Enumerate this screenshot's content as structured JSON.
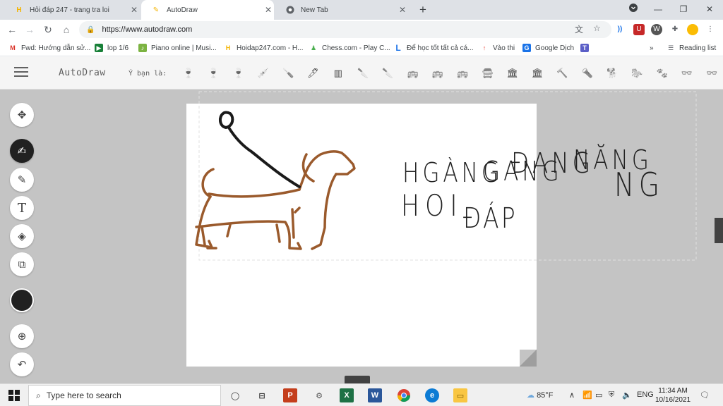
{
  "browser": {
    "tabs": [
      {
        "title": "Hỏi đáp 247 - trang tra loi",
        "icon": "hoidap-favicon"
      },
      {
        "title": "AutoDraw",
        "icon": "autodraw-favicon"
      },
      {
        "title": "New Tab",
        "icon": "chrome-favicon"
      }
    ],
    "url": "https://www.autodraw.com",
    "bookmarks": [
      {
        "label": "Fwd: Hướng dẫn sử...",
        "icon": "gmail-icon",
        "color": "#d93025"
      },
      {
        "label": "lop 1/6",
        "icon": "meet-icon",
        "color": "#188038"
      },
      {
        "label": "Piano online | Musi...",
        "icon": "piano-icon",
        "color": "#7cb342"
      },
      {
        "label": "Hoidap247.com - H...",
        "icon": "hoidap-icon",
        "color": "#f4b400"
      },
      {
        "label": "Chess.com - Play C...",
        "icon": "chess-icon",
        "color": "#4caf50"
      },
      {
        "label": "Để học tốt tất cả cá...",
        "icon": "loigiaihay-icon",
        "color": "#1a73e8"
      },
      {
        "label": "Vào thi",
        "icon": "arrow-icon",
        "color": "#ea4335"
      },
      {
        "label": "Google Dịch",
        "icon": "translate-icon",
        "color": "#1a73e8"
      }
    ],
    "more_bookmarks": "»",
    "reading_list": "Reading list"
  },
  "autodraw": {
    "brand": "AutoDraw",
    "suggest_label": "Ý bạn là:",
    "suggestions": [
      "wine-glass",
      "wine-glass",
      "wine-glass",
      "syringe",
      "screwdriver",
      "pen",
      "comb",
      "knife",
      "knife",
      "bus",
      "bus",
      "bus",
      "school-bus",
      "building",
      "building",
      "hammer",
      "flashlight",
      "dog",
      "horse",
      "animal",
      "glasses",
      "glasses"
    ],
    "tools": [
      "move-icon",
      "autodraw-icon",
      "draw-icon",
      "type-icon",
      "fill-icon",
      "shape-icon",
      "color-swatch",
      "zoom-icon",
      "undo-icon"
    ],
    "canvas_text": [
      "HGÀNG",
      "GANG",
      "ĐANG",
      "NĂNG",
      "NG",
      "HOI",
      "ĐÁP"
    ],
    "drawing_colors": {
      "dog": "#9a5a2c",
      "leash": "#1a1a1a",
      "text": "#222222"
    }
  },
  "taskbar": {
    "search_placeholder": "Type here to search",
    "weather": "85°F",
    "language": "ENG",
    "time": "11:34 AM",
    "date": "10/16/2021"
  }
}
